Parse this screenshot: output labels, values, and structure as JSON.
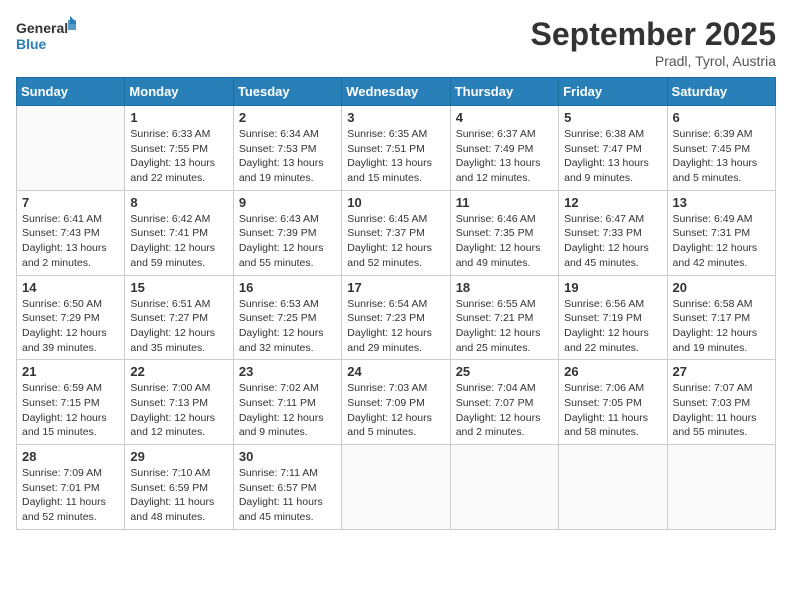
{
  "header": {
    "logo_general": "General",
    "logo_blue": "Blue",
    "title": "September 2025",
    "location": "Pradl, Tyrol, Austria"
  },
  "columns": [
    "Sunday",
    "Monday",
    "Tuesday",
    "Wednesday",
    "Thursday",
    "Friday",
    "Saturday"
  ],
  "weeks": [
    [
      {
        "day": "",
        "info": ""
      },
      {
        "day": "1",
        "info": "Sunrise: 6:33 AM\nSunset: 7:55 PM\nDaylight: 13 hours\nand 22 minutes."
      },
      {
        "day": "2",
        "info": "Sunrise: 6:34 AM\nSunset: 7:53 PM\nDaylight: 13 hours\nand 19 minutes."
      },
      {
        "day": "3",
        "info": "Sunrise: 6:35 AM\nSunset: 7:51 PM\nDaylight: 13 hours\nand 15 minutes."
      },
      {
        "day": "4",
        "info": "Sunrise: 6:37 AM\nSunset: 7:49 PM\nDaylight: 13 hours\nand 12 minutes."
      },
      {
        "day": "5",
        "info": "Sunrise: 6:38 AM\nSunset: 7:47 PM\nDaylight: 13 hours\nand 9 minutes."
      },
      {
        "day": "6",
        "info": "Sunrise: 6:39 AM\nSunset: 7:45 PM\nDaylight: 13 hours\nand 5 minutes."
      }
    ],
    [
      {
        "day": "7",
        "info": "Sunrise: 6:41 AM\nSunset: 7:43 PM\nDaylight: 13 hours\nand 2 minutes."
      },
      {
        "day": "8",
        "info": "Sunrise: 6:42 AM\nSunset: 7:41 PM\nDaylight: 12 hours\nand 59 minutes."
      },
      {
        "day": "9",
        "info": "Sunrise: 6:43 AM\nSunset: 7:39 PM\nDaylight: 12 hours\nand 55 minutes."
      },
      {
        "day": "10",
        "info": "Sunrise: 6:45 AM\nSunset: 7:37 PM\nDaylight: 12 hours\nand 52 minutes."
      },
      {
        "day": "11",
        "info": "Sunrise: 6:46 AM\nSunset: 7:35 PM\nDaylight: 12 hours\nand 49 minutes."
      },
      {
        "day": "12",
        "info": "Sunrise: 6:47 AM\nSunset: 7:33 PM\nDaylight: 12 hours\nand 45 minutes."
      },
      {
        "day": "13",
        "info": "Sunrise: 6:49 AM\nSunset: 7:31 PM\nDaylight: 12 hours\nand 42 minutes."
      }
    ],
    [
      {
        "day": "14",
        "info": "Sunrise: 6:50 AM\nSunset: 7:29 PM\nDaylight: 12 hours\nand 39 minutes."
      },
      {
        "day": "15",
        "info": "Sunrise: 6:51 AM\nSunset: 7:27 PM\nDaylight: 12 hours\nand 35 minutes."
      },
      {
        "day": "16",
        "info": "Sunrise: 6:53 AM\nSunset: 7:25 PM\nDaylight: 12 hours\nand 32 minutes."
      },
      {
        "day": "17",
        "info": "Sunrise: 6:54 AM\nSunset: 7:23 PM\nDaylight: 12 hours\nand 29 minutes."
      },
      {
        "day": "18",
        "info": "Sunrise: 6:55 AM\nSunset: 7:21 PM\nDaylight: 12 hours\nand 25 minutes."
      },
      {
        "day": "19",
        "info": "Sunrise: 6:56 AM\nSunset: 7:19 PM\nDaylight: 12 hours\nand 22 minutes."
      },
      {
        "day": "20",
        "info": "Sunrise: 6:58 AM\nSunset: 7:17 PM\nDaylight: 12 hours\nand 19 minutes."
      }
    ],
    [
      {
        "day": "21",
        "info": "Sunrise: 6:59 AM\nSunset: 7:15 PM\nDaylight: 12 hours\nand 15 minutes."
      },
      {
        "day": "22",
        "info": "Sunrise: 7:00 AM\nSunset: 7:13 PM\nDaylight: 12 hours\nand 12 minutes."
      },
      {
        "day": "23",
        "info": "Sunrise: 7:02 AM\nSunset: 7:11 PM\nDaylight: 12 hours\nand 9 minutes."
      },
      {
        "day": "24",
        "info": "Sunrise: 7:03 AM\nSunset: 7:09 PM\nDaylight: 12 hours\nand 5 minutes."
      },
      {
        "day": "25",
        "info": "Sunrise: 7:04 AM\nSunset: 7:07 PM\nDaylight: 12 hours\nand 2 minutes."
      },
      {
        "day": "26",
        "info": "Sunrise: 7:06 AM\nSunset: 7:05 PM\nDaylight: 11 hours\nand 58 minutes."
      },
      {
        "day": "27",
        "info": "Sunrise: 7:07 AM\nSunset: 7:03 PM\nDaylight: 11 hours\nand 55 minutes."
      }
    ],
    [
      {
        "day": "28",
        "info": "Sunrise: 7:09 AM\nSunset: 7:01 PM\nDaylight: 11 hours\nand 52 minutes."
      },
      {
        "day": "29",
        "info": "Sunrise: 7:10 AM\nSunset: 6:59 PM\nDaylight: 11 hours\nand 48 minutes."
      },
      {
        "day": "30",
        "info": "Sunrise: 7:11 AM\nSunset: 6:57 PM\nDaylight: 11 hours\nand 45 minutes."
      },
      {
        "day": "",
        "info": ""
      },
      {
        "day": "",
        "info": ""
      },
      {
        "day": "",
        "info": ""
      },
      {
        "day": "",
        "info": ""
      }
    ]
  ]
}
